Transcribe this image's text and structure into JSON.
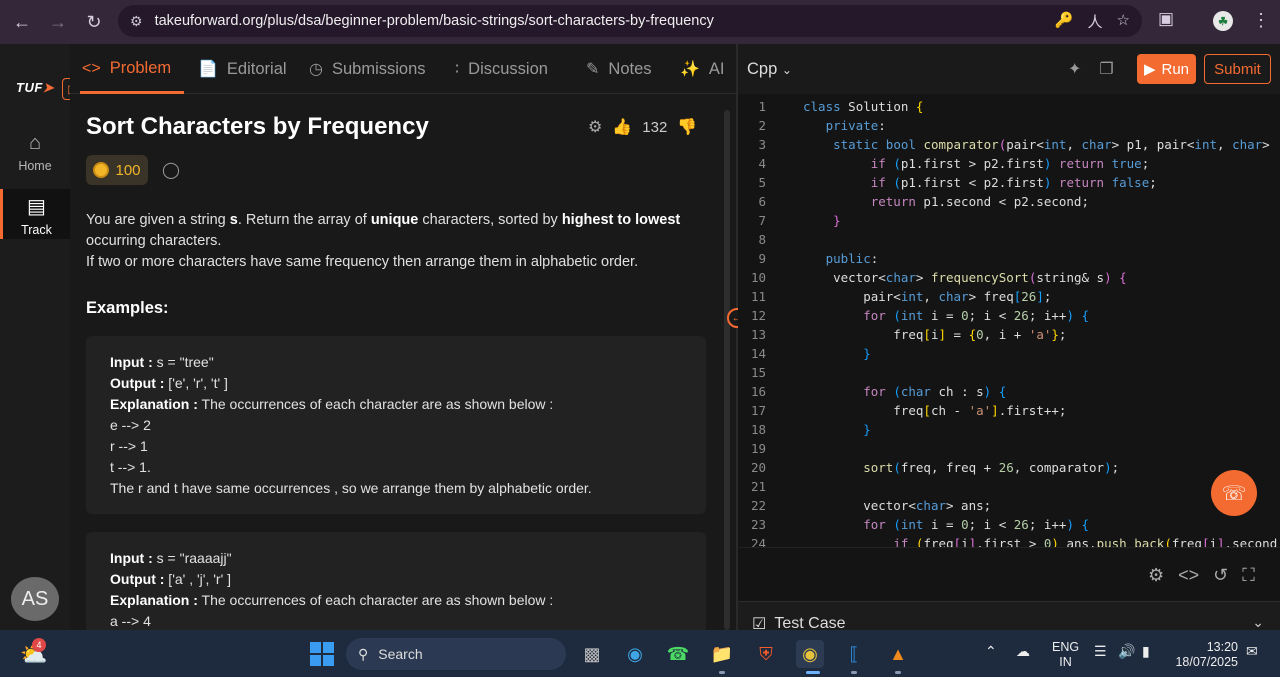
{
  "browser": {
    "url": "takeuforward.org/plus/dsa/beginner-problem/basic-strings/sort-characters-by-frequency"
  },
  "rail": {
    "logo": "TUF",
    "items": [
      {
        "label": "Home",
        "icon": "home-icon"
      },
      {
        "label": "Track",
        "icon": "track-icon"
      }
    ],
    "avatar": "AS"
  },
  "tabs": [
    {
      "label": "Problem",
      "icon": "code-icon"
    },
    {
      "label": "Editorial",
      "icon": "document-icon"
    },
    {
      "label": "Submissions",
      "icon": "clock-icon"
    },
    {
      "label": "Discussion",
      "icon": "people-icon"
    },
    {
      "label": "Notes",
      "icon": "notes-icon"
    },
    {
      "label": "AI",
      "icon": "sparkle-icon"
    }
  ],
  "problem": {
    "title": "Sort Characters by Frequency",
    "likes": "132",
    "coins": "100",
    "desc_1": "You are given a string ",
    "desc_s": "s",
    "desc_2": ". Return the array of ",
    "desc_unique": "unique",
    "desc_3": " characters, sorted by ",
    "desc_highest": "highest to lowest",
    "desc_4": " occurring characters.",
    "desc_5": "If two or more characters have same frequency then arrange them in alphabetic order.",
    "examples_title": "Examples:"
  },
  "examples": [
    {
      "input_label": "Input :",
      "input": " s = \"tree\"",
      "output_label": "Output :",
      "output": " ['e', 'r', 't' ]",
      "explanation_label": "Explanation :",
      "explanation": " The occurrences of each character are as shown below :",
      "lines": [
        "e --> 2",
        "r --> 1",
        "t --> 1.",
        "The r and t have same occurrences , so we arrange them by alphabetic order."
      ]
    },
    {
      "input_label": "Input :",
      "input": " s = \"raaaajj\"",
      "output_label": "Output :",
      "output": " ['a' , 'j', 'r' ]",
      "explanation_label": "Explanation :",
      "explanation": " The occurrences of each character are as shown below :",
      "lines": [
        "a --> 4"
      ]
    }
  ],
  "editor": {
    "language": "Cpp",
    "run_label": "Run",
    "submit_label": "Submit",
    "testcase_label": "Test Case"
  },
  "taskbar": {
    "search_placeholder": "Search",
    "weather_badge": "4",
    "lang_top": "ENG",
    "lang_bottom": "IN",
    "time": "13:20",
    "date": "18/07/2025"
  }
}
